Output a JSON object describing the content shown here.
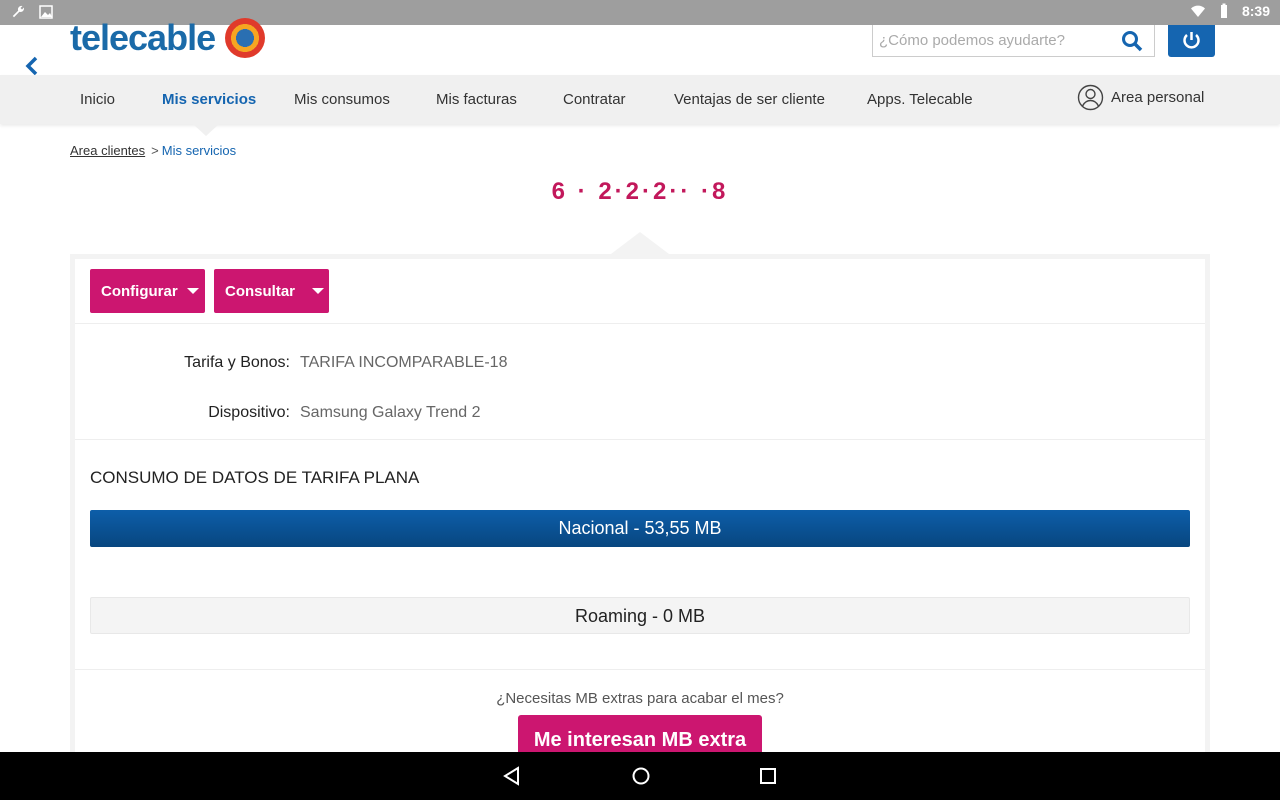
{
  "statusbar": {
    "time": "8:39"
  },
  "header": {
    "logo_text": "telecable",
    "search_placeholder": "¿Cómo podemos ayudarte?"
  },
  "nav": {
    "items": [
      {
        "label": "Inicio"
      },
      {
        "label": "Mis servicios"
      },
      {
        "label": "Mis consumos"
      },
      {
        "label": "Mis facturas"
      },
      {
        "label": "Contratar"
      },
      {
        "label": "Ventajas de ser cliente"
      },
      {
        "label": "Apps. Telecable"
      }
    ],
    "active_index": 1,
    "area_personal": "Area personal"
  },
  "breadcrumb": {
    "root": "Area clientes",
    "separator": ">",
    "current": "Mis servicios"
  },
  "phone_number": "6 · 2·2·2·· ·8",
  "actions": {
    "configurar": "Configurar",
    "consultar": "Consultar"
  },
  "details": {
    "tarifa_label": "Tarifa y Bonos:",
    "tarifa_value": "TARIFA INCOMPARABLE-18",
    "dispositivo_label": "Dispositivo:",
    "dispositivo_value": "Samsung Galaxy Trend 2"
  },
  "consumo": {
    "title": "CONSUMO DE DATOS DE TARIFA PLANA",
    "nacional": "Nacional - 53,55 MB",
    "roaming": "Roaming - 0 MB"
  },
  "extra": {
    "question": "¿Necesitas MB extras para acabar el mes?",
    "button": "Me interesan MB extra"
  },
  "colors": {
    "brand_blue": "#1565b0",
    "brand_magenta": "#cc1670"
  }
}
